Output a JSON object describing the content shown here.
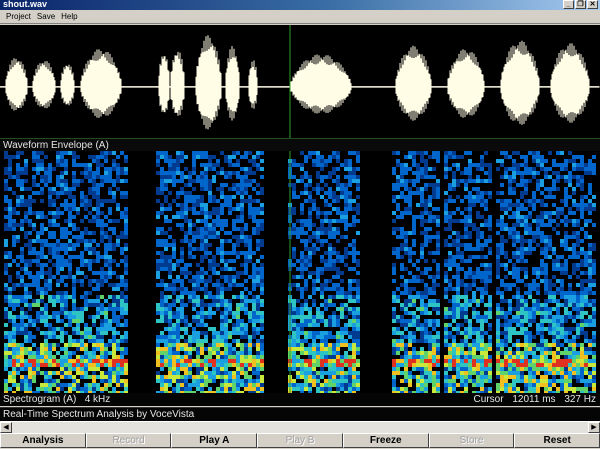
{
  "window": {
    "title": "shout.wav",
    "minimize": "_",
    "restore": "❐",
    "close": "✕"
  },
  "menu": {
    "items": [
      "Project",
      "Save",
      "Help"
    ]
  },
  "waveform": {
    "label": "Waveform Envelope (A)",
    "color": "#fffde6",
    "cursor_color": "#2e9e2e"
  },
  "spectrogram": {
    "label": "Spectrogram (A)",
    "range": "4 kHz",
    "cursor_prefix": "Cursor",
    "cursor_time": "12011 ms",
    "cursor_freq": "327  Hz"
  },
  "status": {
    "text": "Real-Time Spectrum Analysis by VoceVista"
  },
  "scrollbar": {
    "left_arrow": "◀",
    "right_arrow": "▶"
  },
  "toolbar": {
    "buttons": [
      {
        "label": "Analysis",
        "enabled": true
      },
      {
        "label": "Record",
        "enabled": false
      },
      {
        "label": "Play A",
        "enabled": true
      },
      {
        "label": "Play B",
        "enabled": false
      },
      {
        "label": "Freeze",
        "enabled": true
      },
      {
        "label": "Store",
        "enabled": false
      },
      {
        "label": "Reset",
        "enabled": true
      }
    ]
  }
}
